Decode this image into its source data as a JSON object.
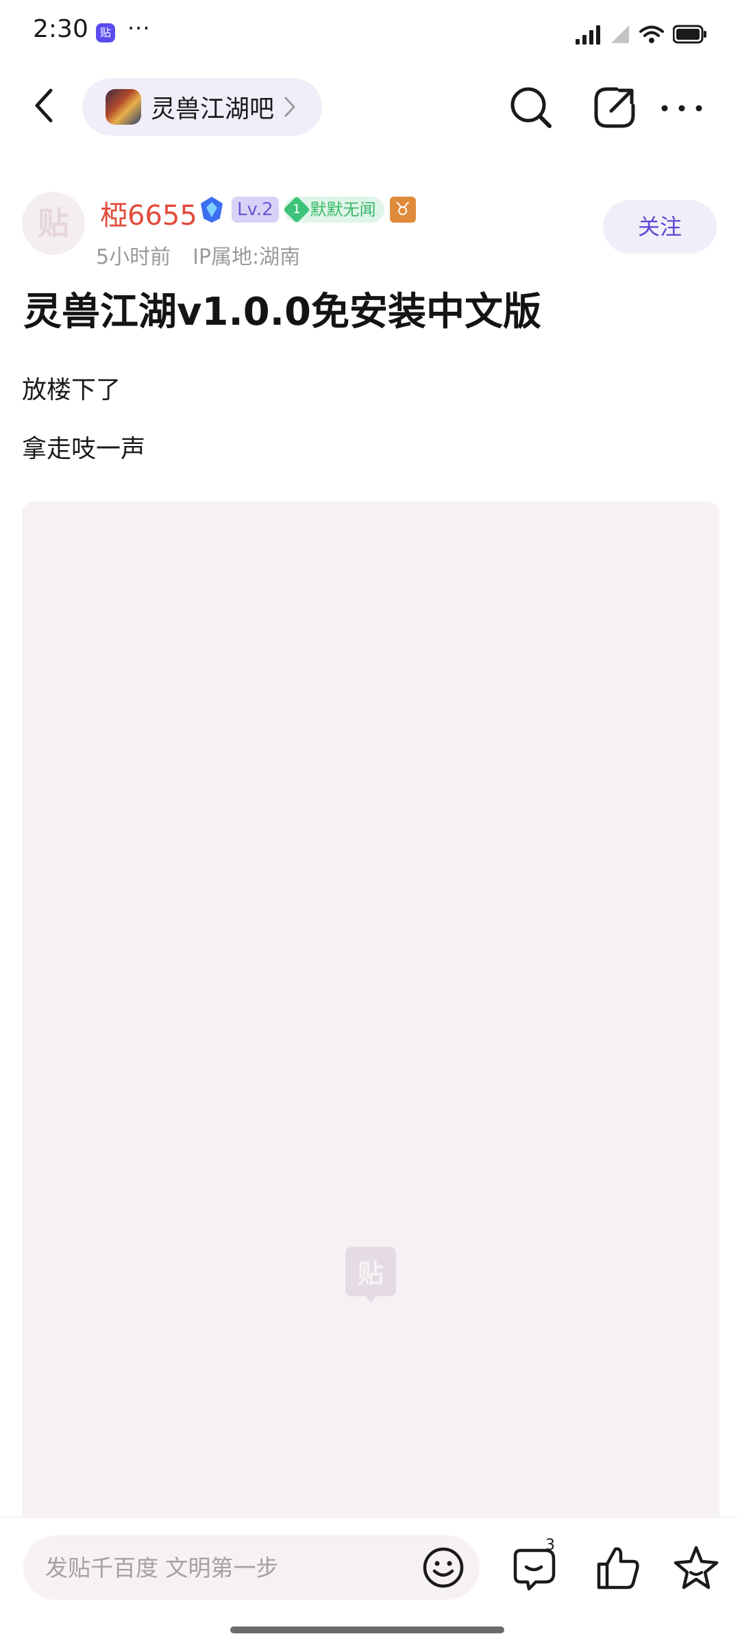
{
  "status_bar": {
    "time": "2:30",
    "app_badge": "贴",
    "more": "···"
  },
  "nav": {
    "forum_name": "灵兽江湖吧"
  },
  "author": {
    "avatar_glyph": "贴",
    "name": "椏6655",
    "level": "Lv.2",
    "fan_level": "1",
    "fan_title": "默默无闻",
    "zodiac": "♉",
    "time": "5小时前",
    "ip": "IP属地:湖南",
    "follow_label": "关注"
  },
  "post": {
    "title": "灵兽江湖v1.0.0免安装中文版",
    "lines": [
      "放楼下了",
      "拿走吱一声"
    ]
  },
  "bottom_bar": {
    "reply_placeholder": "发贴千百度 文明第一步",
    "comment_count": "3"
  },
  "colors": {
    "author_name": "#e24a3b",
    "accent": "#5a4ad6",
    "image_bg": "#f6f1f5"
  }
}
